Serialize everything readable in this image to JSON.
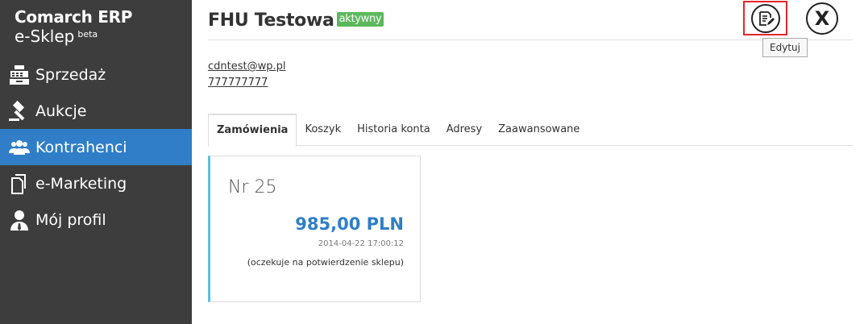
{
  "brand": {
    "line1": "Comarch ERP",
    "line2": "e-Sklep",
    "sup": "beta"
  },
  "sidebar": {
    "items": [
      {
        "label": "Sprzedaż",
        "icon": "cash-register-icon"
      },
      {
        "label": "Aukcje",
        "icon": "gavel-icon"
      },
      {
        "label": "Kontrahenci",
        "icon": "users-icon"
      },
      {
        "label": "e-Marketing",
        "icon": "documents-icon"
      },
      {
        "label": "Mój profil",
        "icon": "user-profile-icon"
      }
    ],
    "active": "Kontrahenci"
  },
  "header": {
    "title": "FHU Testowa",
    "badge": "aktywny",
    "edit_tooltip": "Edytuj"
  },
  "contact": {
    "email": "cdntest@wp.pl",
    "phone": "777777777"
  },
  "tabs": [
    {
      "label": "Zamówienia"
    },
    {
      "label": "Koszyk"
    },
    {
      "label": "Historia konta"
    },
    {
      "label": "Adresy"
    },
    {
      "label": "Zaawansowane"
    }
  ],
  "order": {
    "number": "Nr 25",
    "amount": "985,00 PLN",
    "date": "2014-04-22 17:00:12",
    "status": "(oczekuje na potwierdzenie sklepu)"
  },
  "colors": {
    "sidebar_bg": "#3d3d3d",
    "active_nav": "#2f7ec7",
    "badge_green": "#5cb85c",
    "highlight_red": "#e0262b",
    "card_accent": "#5bc0de"
  }
}
